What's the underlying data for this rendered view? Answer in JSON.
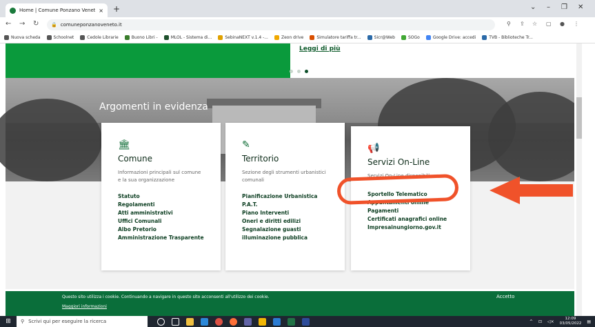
{
  "browser": {
    "tab_title": "Home | Comune Ponzano Veneto",
    "tab_close": "×",
    "new_tab": "+",
    "url": "comuneponzanoveneto.it",
    "bookmarks": [
      {
        "label": "Nuova scheda",
        "color": "#555555"
      },
      {
        "label": "Schoolnet",
        "color": "#555555"
      },
      {
        "label": "Cedole Librarie",
        "color": "#555555"
      },
      {
        "label": "Buono Libri -",
        "color": "#3a7d2c"
      },
      {
        "label": "MLOL - Sistema di...",
        "color": "#1d4f2b"
      },
      {
        "label": "SebinaNEXT v.1.4 -...",
        "color": "#e0a100"
      },
      {
        "label": "Zeon drive",
        "color": "#f0a800"
      },
      {
        "label": "Simulatore tariffa tr...",
        "color": "#d94f00"
      },
      {
        "label": "Sicr@Web",
        "color": "#2b6aa8"
      },
      {
        "label": "SOGo",
        "color": "#41a834"
      },
      {
        "label": "Google Drive: accedi",
        "color": "#4285f4"
      },
      {
        "label": "TVB - Biblioteche Tr...",
        "color": "#2b6aa8"
      }
    ]
  },
  "page": {
    "read_more": "Leggi di più",
    "section_title": "Argomenti in evidenza",
    "cards": [
      {
        "icon": "bank-icon",
        "icon_glyph": "🏛",
        "title": "Comune",
        "desc": "Informazioni principali sul comune e la sua organizzazione",
        "links": [
          "Statuto",
          "Regolamenti",
          "Atti amministrativi",
          "Uffici Comunali",
          "Albo Pretorio",
          "Amministrazione Trasparente"
        ]
      },
      {
        "icon": "pencil-icon",
        "icon_glyph": "✎",
        "title": "Territorio",
        "desc": "Sezione degli strumenti urbanistici comunali",
        "links": [
          "Pianificazione Urbanistica",
          "P.A.T.",
          "Piano Interventi",
          "Oneri e diritti edilizi",
          "Segnalazione guasti illuminazione pubblica"
        ]
      },
      {
        "icon": "megaphone-icon",
        "icon_glyph": "📢",
        "title": "Servizi On-Line",
        "desc": "Servizi On-Line disponibili",
        "links": [
          "Sportello Telematico",
          "Appuntamenti online",
          "Pagamenti",
          "Certificati anagrafici online",
          "Impresainungiorno.gov.it"
        ]
      }
    ],
    "cookie": {
      "message": "Questo sito utilizza i cookie. Continuando a navigare in questo sito acconsenti all'utilizzo dei cookie.",
      "more": "Maggiori informazioni",
      "accept": "Accetto"
    }
  },
  "annotation": {
    "ring_color": "#f0522a",
    "arrow_color": "#f0522a"
  },
  "taskbar": {
    "search_placeholder": "Scrivi qui per eseguire la ricerca",
    "time": "12:09",
    "date": "03/05/2022"
  }
}
